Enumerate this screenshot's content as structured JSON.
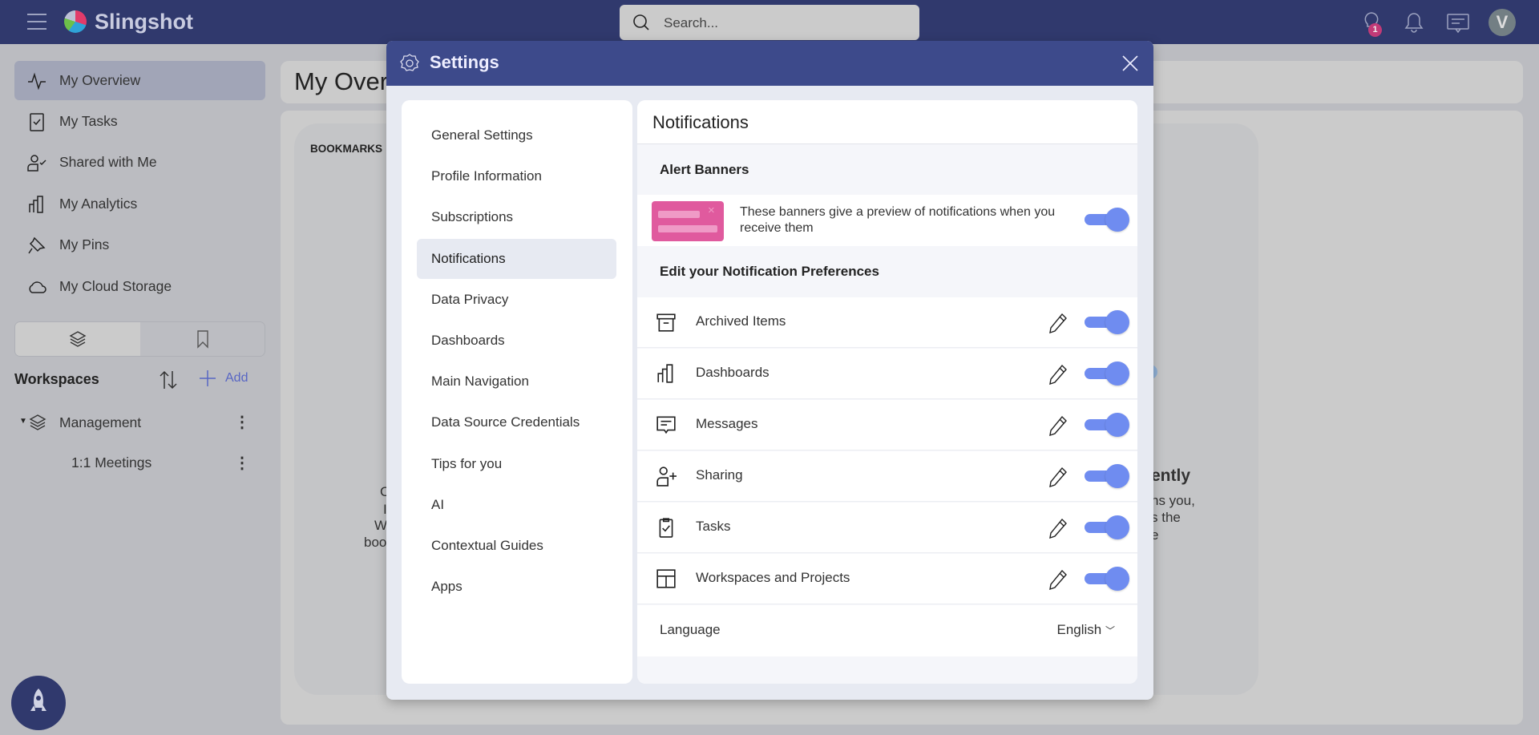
{
  "topbar": {
    "brand": "Slingshot",
    "search_placeholder": "Search...",
    "tips_badge": "1",
    "avatar_initial": "V"
  },
  "sidebar": {
    "items": [
      {
        "label": "My Overview",
        "icon": "activity-icon",
        "selected": true
      },
      {
        "label": "My Tasks",
        "icon": "clipboard-check-icon"
      },
      {
        "label": "Shared with Me",
        "icon": "user-check-icon"
      },
      {
        "label": "My Analytics",
        "icon": "bar-chart-icon"
      },
      {
        "label": "My Pins",
        "icon": "pin-icon"
      },
      {
        "label": "My Cloud Storage",
        "icon": "cloud-icon"
      }
    ],
    "workspaces_label": "Workspaces",
    "add_label": "Add",
    "tree": [
      {
        "label": "Management",
        "expanded": true
      },
      {
        "label": "1:1 Meetings"
      }
    ]
  },
  "main": {
    "title": "My Overview",
    "bookmarks_label": "BOOKMARKS",
    "left_fragments": [
      "C",
      "I",
      "W",
      "boo"
    ],
    "right_fragments": [
      "ently",
      "ns you,",
      "s the",
      "e"
    ]
  },
  "settings": {
    "title": "Settings",
    "nav": [
      "General Settings",
      "Profile Information",
      "Subscriptions",
      "Notifications",
      "Data Privacy",
      "Dashboards",
      "Main Navigation",
      "Data Source Credentials",
      "Tips for you",
      "AI",
      "Contextual Guides",
      "Apps"
    ],
    "selected_nav": "Notifications",
    "panel": {
      "title": "Notifications",
      "alert_banners_heading": "Alert Banners",
      "alert_banner_text": "These banners give a preview of notifications when you receive them",
      "alert_banner_enabled": true,
      "prefs_heading": "Edit your Notification Preferences",
      "prefs": [
        {
          "label": "Archived Items",
          "icon": "archive-icon",
          "enabled": true
        },
        {
          "label": "Dashboards",
          "icon": "bar-chart-icon",
          "enabled": true
        },
        {
          "label": "Messages",
          "icon": "message-icon",
          "enabled": true
        },
        {
          "label": "Sharing",
          "icon": "user-plus-icon",
          "enabled": true
        },
        {
          "label": "Tasks",
          "icon": "clipboard-check-icon",
          "enabled": true
        },
        {
          "label": "Workspaces and Projects",
          "icon": "layout-icon",
          "enabled": true
        }
      ],
      "language_label": "Language",
      "language_value": "English"
    }
  },
  "colors": {
    "topbar": "#30396d",
    "modal_header": "#3d4a8b",
    "toggle": "#6f8cf0",
    "banner": "#e05a9e",
    "badge": "#c13a77"
  }
}
